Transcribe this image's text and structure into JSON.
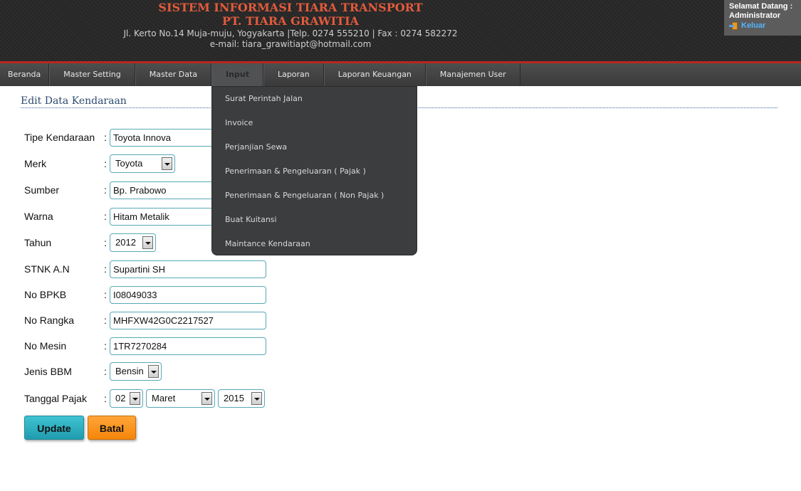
{
  "header": {
    "title": "SISTEM INFORMASI TIARA TRANSPORT",
    "company": "PT. TIARA GRAWITIA",
    "address": "Jl. Kerto No.14 Muja-muju, Yogyakarta  |Telp. 0274 555210 | Fax : 0274 582272",
    "email": "e-mail: tiara_grawitiapt@hotmail.com",
    "welcome_label": "Selamat Datang :",
    "user": "Administrator",
    "logout_label": "Keluar"
  },
  "nav": {
    "items": [
      "Beranda",
      "Master Setting",
      "Master Data",
      "Input",
      "Laporan",
      "Laporan Keuangan",
      "Manajemen User"
    ],
    "active": "Input"
  },
  "dropdown": {
    "items": [
      "Surat Perintah Jalan",
      "Invoice",
      "Perjanjian Sewa",
      "Penerimaan & Pengeluaran ( Pajak )",
      "Penerimaan & Pengeluaran ( Non Pajak )",
      "Buat Kuitansi",
      "Maintance Kendaraan"
    ]
  },
  "form": {
    "title": "Edit Data Kendaraan",
    "colon": ":",
    "fields": {
      "tipe": {
        "label": "Tipe Kendaraan",
        "value": "Toyota Innova"
      },
      "merk": {
        "label": "Merk",
        "value": "Toyota"
      },
      "sumber": {
        "label": "Sumber",
        "value": "Bp. Prabowo"
      },
      "warna": {
        "label": "Warna",
        "value": "Hitam Metalik"
      },
      "tahun": {
        "label": "Tahun",
        "value": "2012"
      },
      "stnk": {
        "label": "STNK A.N",
        "value": "Supartini SH"
      },
      "bpkb": {
        "label": "No BPKB",
        "value": "I08049033"
      },
      "rangka": {
        "label": "No Rangka",
        "value": "MHFXW42G0C2217527"
      },
      "mesin": {
        "label": "No Mesin",
        "value": "1TR7270284"
      },
      "bbm": {
        "label": "Jenis BBM",
        "value": "Bensin"
      },
      "pajak": {
        "label": "Tanggal Pajak",
        "day": "02",
        "month": "Maret",
        "year": "2015"
      }
    },
    "update_label": "Update",
    "cancel_label": "Batal"
  }
}
